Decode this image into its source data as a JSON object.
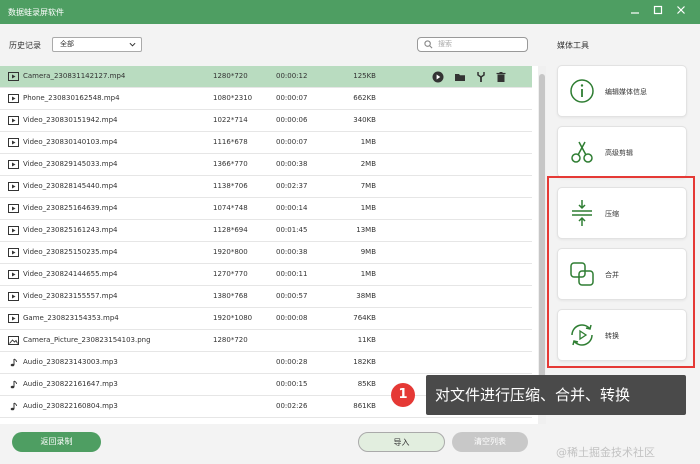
{
  "window": {
    "title": "数据蛙录屏软件",
    "min_icon": "minimize-icon",
    "max_icon": "maximize-icon",
    "close_icon": "close-icon"
  },
  "toolbar": {
    "history_label": "历史记录",
    "filter_value": "全部",
    "search_placeholder": "搜索"
  },
  "files": [
    {
      "name": "Camera_230831142127.mp4",
      "resolution": "1280*720",
      "duration": "00:00:12",
      "size": "125KB",
      "type": "video",
      "selected": true
    },
    {
      "name": "Phone_230830162548.mp4",
      "resolution": "1080*2310",
      "duration": "00:00:07",
      "size": "662KB",
      "type": "video"
    },
    {
      "name": "Video_230830151942.mp4",
      "resolution": "1022*714",
      "duration": "00:00:06",
      "size": "340KB",
      "type": "video"
    },
    {
      "name": "Video_230830140103.mp4",
      "resolution": "1116*678",
      "duration": "00:00:07",
      "size": "1MB",
      "type": "video"
    },
    {
      "name": "Video_230829145033.mp4",
      "resolution": "1366*770",
      "duration": "00:00:38",
      "size": "2MB",
      "type": "video"
    },
    {
      "name": "Video_230828145440.mp4",
      "resolution": "1138*706",
      "duration": "00:02:37",
      "size": "7MB",
      "type": "video"
    },
    {
      "name": "Video_230825164639.mp4",
      "resolution": "1074*748",
      "duration": "00:00:14",
      "size": "1MB",
      "type": "video"
    },
    {
      "name": "Video_230825161243.mp4",
      "resolution": "1128*694",
      "duration": "00:01:45",
      "size": "13MB",
      "type": "video"
    },
    {
      "name": "Video_230825150235.mp4",
      "resolution": "1920*800",
      "duration": "00:00:38",
      "size": "9MB",
      "type": "video"
    },
    {
      "name": "Video_230824144655.mp4",
      "resolution": "1270*770",
      "duration": "00:00:11",
      "size": "1MB",
      "type": "video"
    },
    {
      "name": "Video_230823155557.mp4",
      "resolution": "1380*768",
      "duration": "00:00:57",
      "size": "38MB",
      "type": "video"
    },
    {
      "name": "Game_230823154353.mp4",
      "resolution": "1920*1080",
      "duration": "00:00:08",
      "size": "764KB",
      "type": "video"
    },
    {
      "name": "Camera_Picture_230823154103.png",
      "resolution": "1280*720",
      "duration": "",
      "size": "11KB",
      "type": "image"
    },
    {
      "name": "Audio_230823143003.mp3",
      "resolution": "",
      "duration": "00:00:28",
      "size": "182KB",
      "type": "audio"
    },
    {
      "name": "Audio_230822161647.mp3",
      "resolution": "",
      "duration": "00:00:15",
      "size": "85KB",
      "type": "audio"
    },
    {
      "name": "Audio_230822160804.mp3",
      "resolution": "",
      "duration": "00:02:26",
      "size": "861KB",
      "type": "audio"
    }
  ],
  "row_actions": [
    "play-icon",
    "folder-icon",
    "edit-tool-icon",
    "trash-icon"
  ],
  "media_tools": {
    "title": "媒体工具",
    "items": [
      {
        "label": "编辑媒体信息",
        "icon": "info-icon"
      },
      {
        "label": "高级剪辑",
        "icon": "scissors-icon"
      },
      {
        "label": "压缩",
        "icon": "compress-icon"
      },
      {
        "label": "合并",
        "icon": "merge-icon"
      },
      {
        "label": "转换",
        "icon": "convert-icon"
      }
    ]
  },
  "annotation": {
    "number": "1",
    "text": "对文件进行压缩、合并、转换"
  },
  "footer": {
    "back_label": "返回录制",
    "import_label": "导入",
    "clear_label": "清空列表"
  },
  "watermark": "@稀土掘金技术社区",
  "colors": {
    "accent": "#4e9e62",
    "selected_row": "#b9dcc0",
    "highlight": "#e53935"
  }
}
